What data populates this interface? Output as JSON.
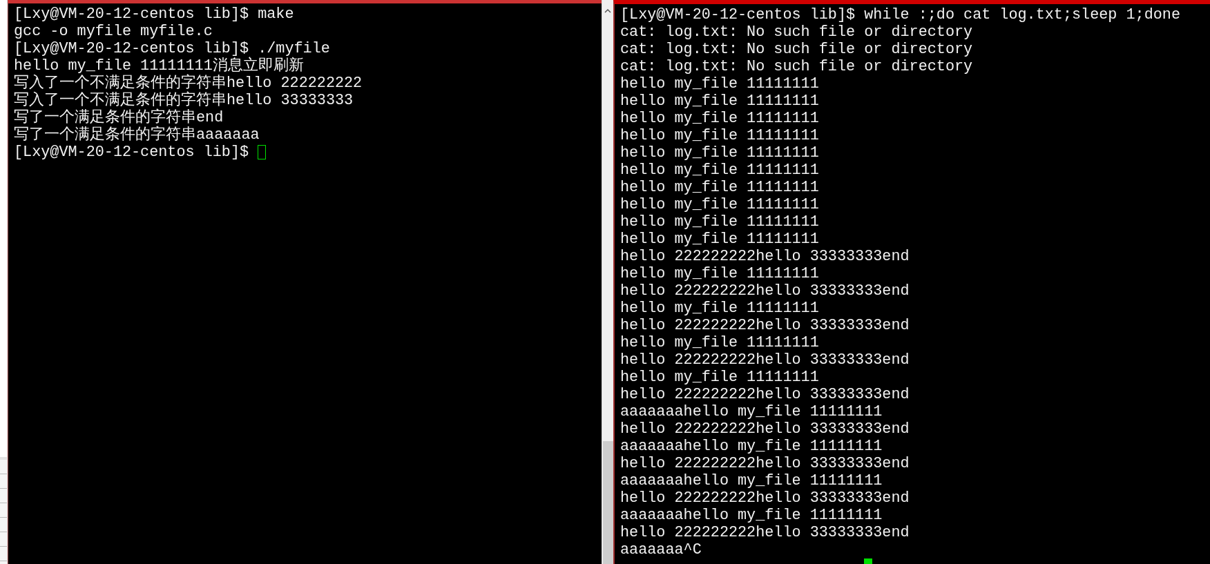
{
  "left_terminal": {
    "cursor_hollow": true,
    "lines": [
      "[Lxy@VM-20-12-centos lib]$ make",
      "gcc -o myfile myfile.c",
      "[Lxy@VM-20-12-centos lib]$ ./myfile",
      "hello my_file 11111111消息立即刷新",
      "写入了一个不满足条件的字符串hello 222222222",
      "写入了一个不满足条件的字符串hello 33333333",
      "写了一个满足条件的字符串end",
      "写了一个满足条件的字符串aaaaaaa",
      "[Lxy@VM-20-12-centos lib]$ "
    ]
  },
  "right_terminal": {
    "cursor_hollow": false,
    "cursor_on_new_line": true,
    "lines": [
      "[Lxy@VM-20-12-centos lib]$ while :;do cat log.txt;sleep 1;done",
      "cat: log.txt: No such file or directory",
      "cat: log.txt: No such file or directory",
      "cat: log.txt: No such file or directory",
      "hello my_file 11111111",
      "hello my_file 11111111",
      "hello my_file 11111111",
      "hello my_file 11111111",
      "hello my_file 11111111",
      "hello my_file 11111111",
      "hello my_file 11111111",
      "hello my_file 11111111",
      "hello my_file 11111111",
      "hello my_file 11111111",
      "hello 222222222hello 33333333end",
      "hello my_file 11111111",
      "hello 222222222hello 33333333end",
      "hello my_file 11111111",
      "hello 222222222hello 33333333end",
      "hello my_file 11111111",
      "hello 222222222hello 33333333end",
      "hello my_file 11111111",
      "hello 222222222hello 33333333end",
      "aaaaaaahello my_file 11111111",
      "hello 222222222hello 33333333end",
      "aaaaaaahello my_file 11111111",
      "hello 222222222hello 33333333end",
      "aaaaaaahello my_file 11111111",
      "hello 222222222hello 33333333end",
      "aaaaaaahello my_file 11111111",
      "hello 222222222hello 33333333end",
      "aaaaaaa^C"
    ]
  }
}
